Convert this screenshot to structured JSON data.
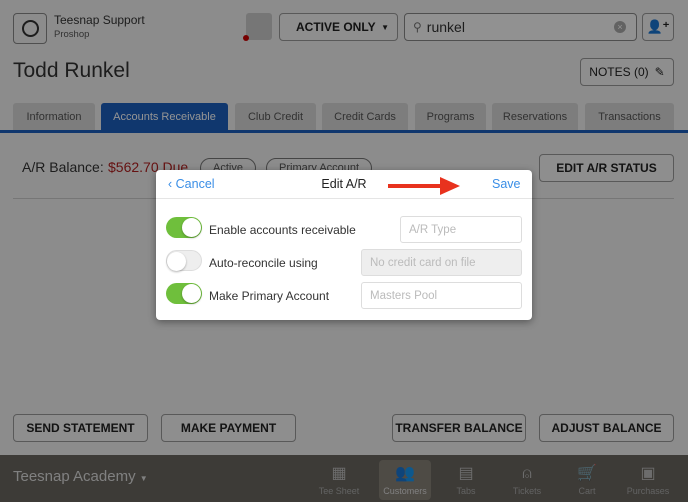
{
  "header": {
    "user_name": "Teesnap Support",
    "user_role": "Proshop",
    "filter": "ACTIVE ONLY",
    "search_value": "runkel"
  },
  "customer": {
    "name": "Todd Runkel",
    "notes_label": "NOTES (0)"
  },
  "tabs": [
    "Information",
    "Accounts Receivable",
    "Club Credit",
    "Credit Cards",
    "Programs",
    "Reservations",
    "Transactions"
  ],
  "active_tab": "Accounts Receivable",
  "ar": {
    "balance_label": "A/R Balance:",
    "balance_value": "$562.70 Due",
    "status_pill": "Active",
    "primary_pill": "Primary Account",
    "edit_status": "EDIT A/R STATUS"
  },
  "actions": {
    "send_statement": "SEND STATEMENT",
    "make_payment": "MAKE PAYMENT",
    "transfer_balance": "TRANSFER BALANCE",
    "adjust_balance": "ADJUST BALANCE"
  },
  "modal": {
    "cancel": "Cancel",
    "title": "Edit A/R",
    "save": "Save",
    "rows": [
      {
        "label": "Enable accounts receivable",
        "on": true,
        "field_placeholder": "A/R Type"
      },
      {
        "label": "Auto-reconcile using",
        "on": false,
        "field_placeholder": "No credit card on file"
      },
      {
        "label": "Make Primary Account",
        "on": true,
        "field_placeholder": "Masters Pool"
      }
    ]
  },
  "bottom": {
    "location": "Teesnap Academy",
    "nav": [
      {
        "label": "Tee Sheet",
        "icon": "calendar-icon"
      },
      {
        "label": "Customers",
        "icon": "people-icon"
      },
      {
        "label": "Tabs",
        "icon": "tabs-icon"
      },
      {
        "label": "Tickets",
        "icon": "bell-icon"
      },
      {
        "label": "Cart",
        "icon": "cart-icon"
      },
      {
        "label": "Purchases",
        "icon": "register-icon"
      }
    ],
    "active": "Customers"
  },
  "colors": {
    "accent": "#1c5fbd",
    "balance_due": "#b02020",
    "toggle_on": "#6fbf3c",
    "link": "#3a8ee6",
    "arrow": "#e8321e"
  }
}
